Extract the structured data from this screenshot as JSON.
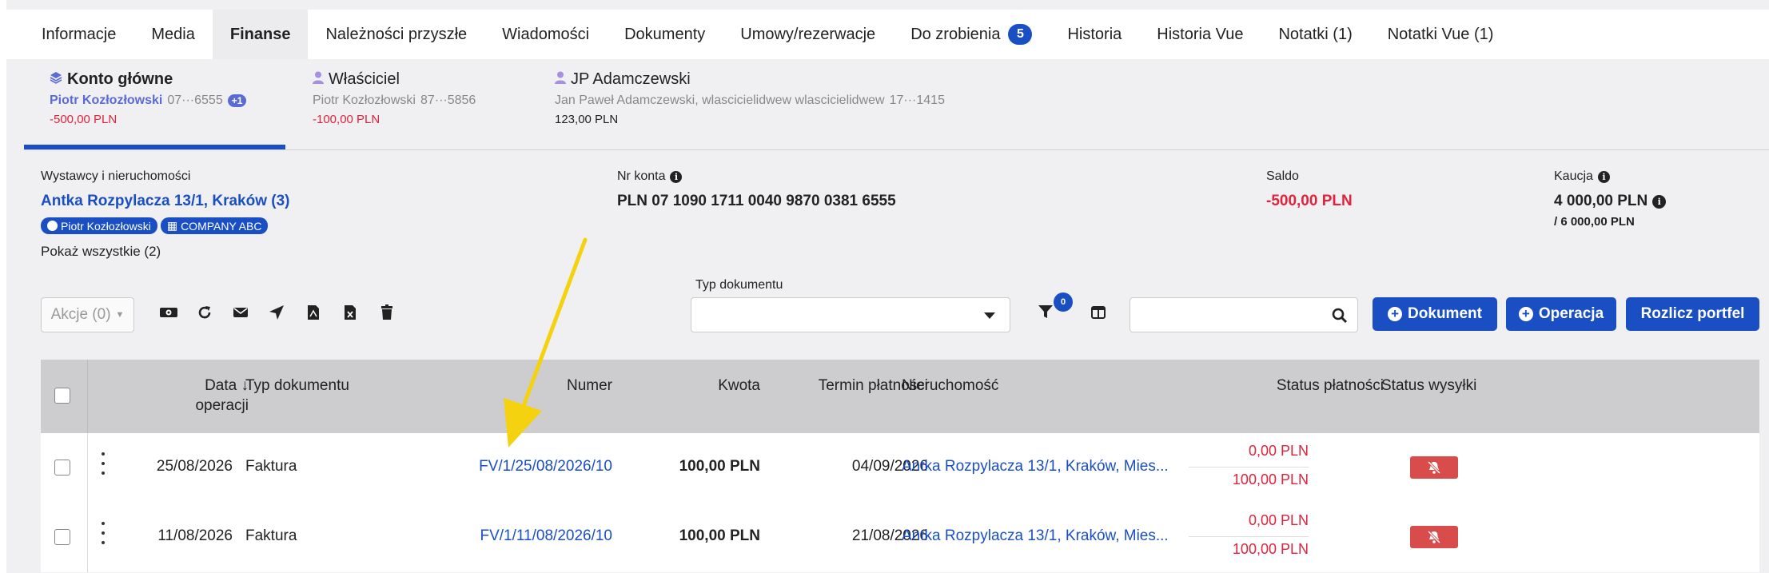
{
  "tabs": [
    {
      "label": "Informacje"
    },
    {
      "label": "Media"
    },
    {
      "label": "Finanse"
    },
    {
      "label": "Należności przyszłe"
    },
    {
      "label": "Wiadomości"
    },
    {
      "label": "Dokumenty"
    },
    {
      "label": "Umowy/rezerwacje"
    },
    {
      "label": "Do zrobienia",
      "badge": "5"
    },
    {
      "label": "Historia"
    },
    {
      "label": "Historia Vue"
    },
    {
      "label": "Notatki (1)"
    },
    {
      "label": "Notatki Vue (1)"
    }
  ],
  "accounts": [
    {
      "title": "Konto główne",
      "owner": "Piotr Kozłozłowski",
      "number": "07···6555",
      "extra": "+1",
      "balance": "-500,00 PLN"
    },
    {
      "title": "Właściciel",
      "owner": "Piotr Kozłozłowski",
      "number": "87···5856",
      "balance": "-100,00 PLN"
    },
    {
      "title": "JP Adamczewski",
      "owner": "Jan Paweł Adamczewski, wlascicielidwew wlascicielidwew",
      "number": "17···1415",
      "balance": "123,00 PLN"
    }
  ],
  "info": {
    "issuers_label": "Wystawcy i nieruchomości",
    "property": "Antka Rozpylacza 13/1, Kraków (3)",
    "tag_person": "Piotr Kozłozłowski",
    "tag_company": "COMPANY ABC",
    "show_all": "Pokaż wszystkie (2)",
    "account_label": "Nr konta",
    "account_number": "PLN 07 1090 1711 0040 9870 0381 6555",
    "balance_label": "Saldo",
    "balance": "-500,00 PLN",
    "deposit_label": "Kaucja",
    "deposit": "4 000,00 PLN",
    "deposit_total": "/ 6 000,00 PLN"
  },
  "toolbar": {
    "actions": "Akcje (0)",
    "doc_type_label": "Typ dokumentu",
    "doc_type_value": "",
    "filter_count": "0",
    "search_placeholder": "",
    "btn_document": "Dokument",
    "btn_operation": "Operacja",
    "btn_settle": "Rozlicz portfel"
  },
  "table": {
    "headers": {
      "date": [
        "Data",
        "operacji"
      ],
      "type": "Typ dokumentu",
      "number": "Numer",
      "amount": "Kwota",
      "due": "Termin płatności",
      "property": "Nieruchomość",
      "pay_status": "Status płatności",
      "send_status": "Status wysyłki"
    },
    "rows": [
      {
        "date": "25/08/2026",
        "type": "Faktura",
        "number": "FV/1/25/08/2026/10",
        "amount": "100,00 PLN",
        "due": "04/09/2026",
        "property": "Antka Rozpylacza 13/1, Kraków, Mies...",
        "paid": "0,00 PLN",
        "total": "100,00 PLN"
      },
      {
        "date": "11/08/2026",
        "type": "Faktura",
        "number": "FV/1/11/08/2026/10",
        "amount": "100,00 PLN",
        "due": "21/08/2026",
        "property": "Antka Rozpylacza 13/1, Kraków, Mies...",
        "paid": "0,00 PLN",
        "total": "100,00 PLN"
      }
    ]
  },
  "colors": {
    "accent": "#1a4fc4",
    "negative": "#e0223d",
    "send_off": "#d94c4c",
    "annotation_arrow": "#f5d20f"
  }
}
